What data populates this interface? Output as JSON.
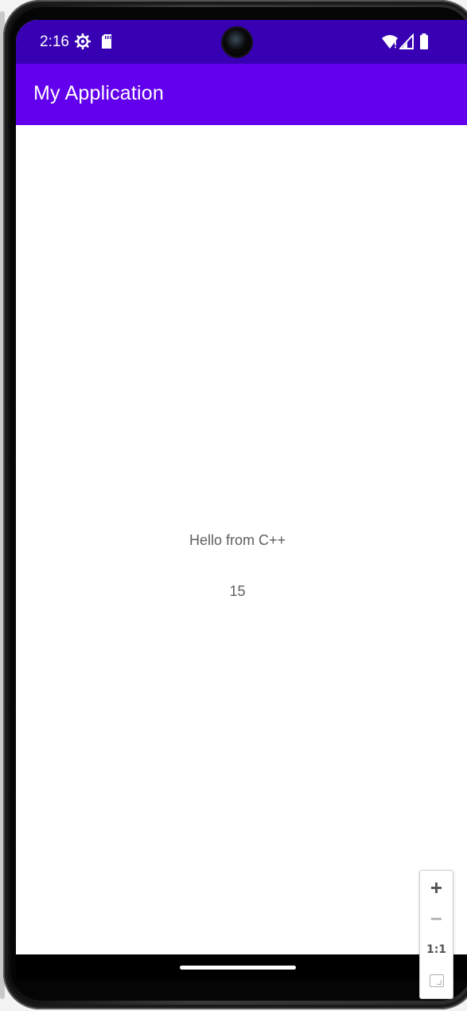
{
  "status_bar": {
    "time": "2:16",
    "icons": [
      "settings-gear-icon",
      "sd-card-icon",
      "wifi-icon",
      "signal-icon",
      "battery-icon"
    ],
    "background": "#3700b3"
  },
  "app_bar": {
    "title": "My Application",
    "background": "#6200ee"
  },
  "content": {
    "hello_text": "Hello from C++",
    "number_text": "15"
  },
  "zoom_controls": {
    "zoom_in_label": "+",
    "zoom_out_label": "−",
    "actual_size_label": "1:1"
  }
}
